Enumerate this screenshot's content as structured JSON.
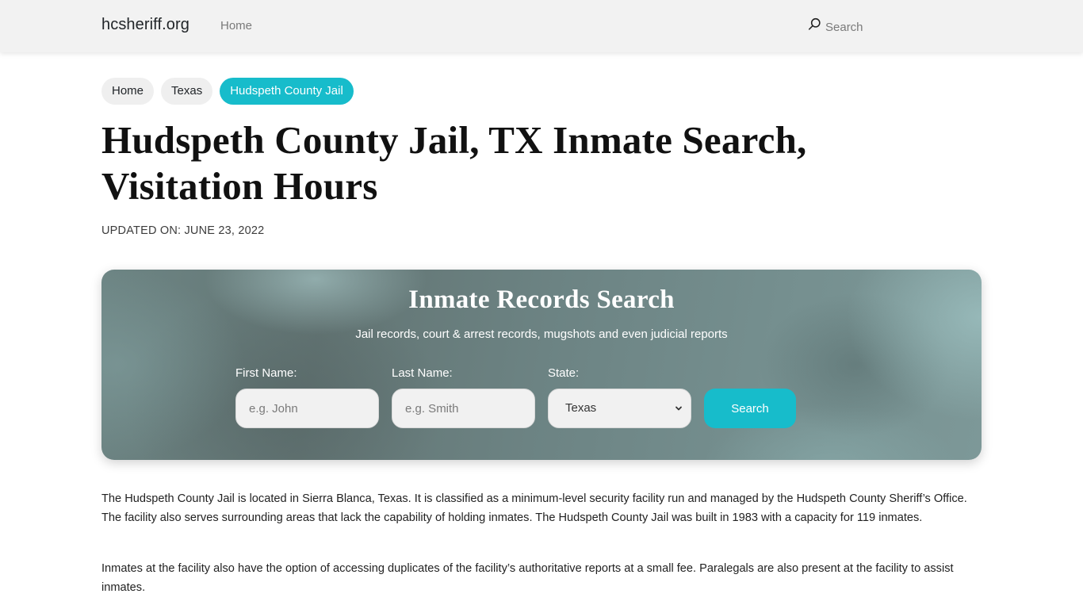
{
  "navbar": {
    "brand": "hcsheriff.org",
    "links": [
      {
        "label": "Home"
      }
    ],
    "search_label": "Search",
    "search_icon": "search-icon"
  },
  "breadcrumb": [
    {
      "label": "Home",
      "active": false
    },
    {
      "label": "Texas",
      "active": false
    },
    {
      "label": "Hudspeth County Jail",
      "active": true
    }
  ],
  "page": {
    "title": "Hudspeth County Jail, TX Inmate Search, Visitation Hours",
    "updated": "UPDATED ON: JUNE 23, 2022"
  },
  "search_card": {
    "title": "Inmate Records Search",
    "subtitle": "Jail records, court & arrest records, mugshots and even judicial reports",
    "first_name": {
      "label": "First Name:",
      "placeholder": "e.g. John",
      "value": ""
    },
    "last_name": {
      "label": "Last Name:",
      "placeholder": "e.g. Smith",
      "value": ""
    },
    "state": {
      "label": "State:",
      "selected": "Texas",
      "icon": "chevron-down-icon"
    },
    "button_label": "Search"
  },
  "content": {
    "paragraphs": [
      "The Hudspeth County Jail is located in Sierra Blanca, Texas. It is classified as a minimum-level security facility run and managed by the Hudspeth County Sheriff’s Office. The facility also serves surrounding areas that lack the capability of holding inmates. The Hudspeth County Jail was built in 1983 with a capacity for 119 inmates.",
      "Inmates at the facility also have the option of accessing duplicates of the facility’s authoritative reports at a small fee. Paralegals are also present at the facility to assist inmates."
    ]
  },
  "colors": {
    "accent": "#17bccb",
    "navbar_bg": "#f2f2f2",
    "crumb_bg": "#efefef"
  }
}
